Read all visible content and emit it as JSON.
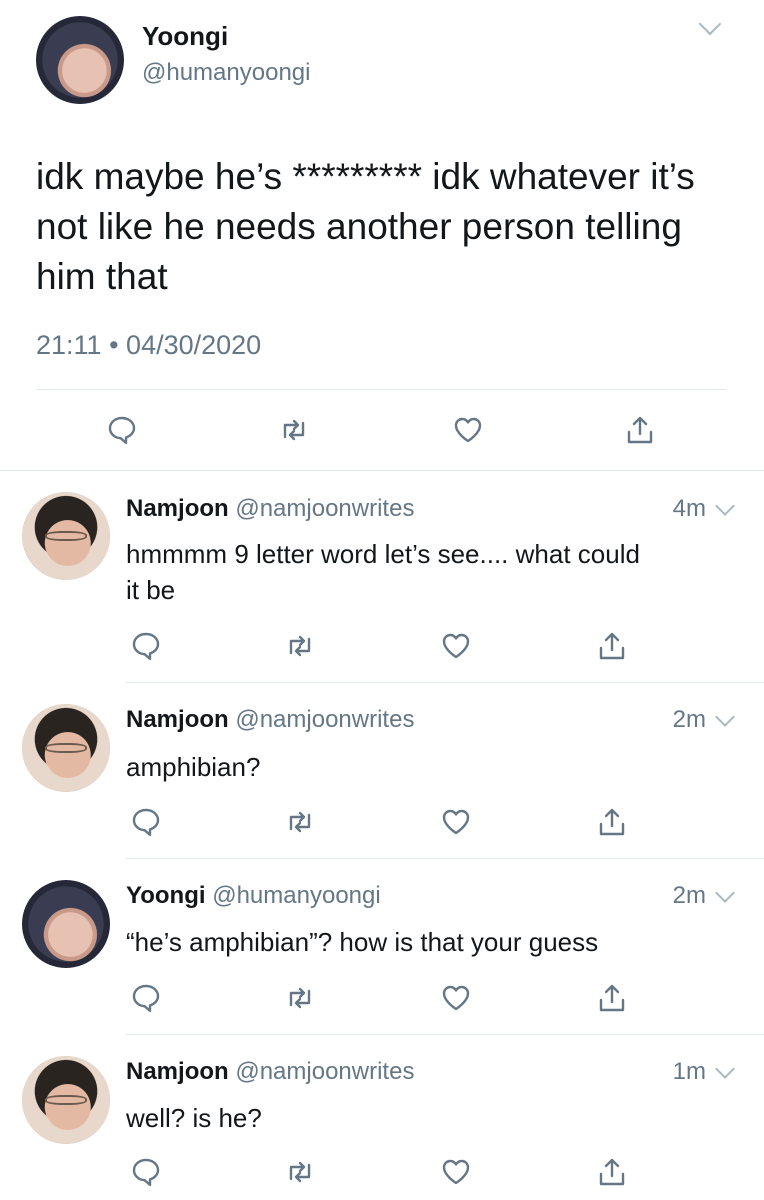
{
  "main_tweet": {
    "name": "Yoongi",
    "handle": "@humanyoongi",
    "text_line1": "idk maybe he’s ********* idk whatever it’s",
    "text_line2": "not like he needs another person telling",
    "text_line3": "him that",
    "time": "21:11",
    "separator": "•",
    "date": "04/30/2020"
  },
  "replies": [
    {
      "name": "Namjoon",
      "handle": "@namjoonwrites",
      "time": "4m",
      "text_line1": "hmmmm 9 letter word let’s see.... what could",
      "text_line2": "it be"
    },
    {
      "name": "Namjoon",
      "handle": "@namjoonwrites",
      "time": "2m",
      "text_line1": "amphibian?"
    },
    {
      "name": "Yoongi",
      "handle": "@humanyoongi",
      "time": "2m",
      "text_line1": "“he’s amphibian”? how is that your guess"
    },
    {
      "name": "Namjoon",
      "handle": "@namjoonwrites",
      "time": "1m",
      "text_line1": "well? is he?"
    }
  ],
  "icons": {
    "reply": "reply-icon",
    "retweet": "retweet-icon",
    "like": "heart-icon",
    "share": "share-icon",
    "menu": "chevron-down-icon"
  },
  "colors": {
    "text": "#14171a",
    "secondary": "#657786",
    "icon": "#657786",
    "divider": "#e1e8ed"
  }
}
